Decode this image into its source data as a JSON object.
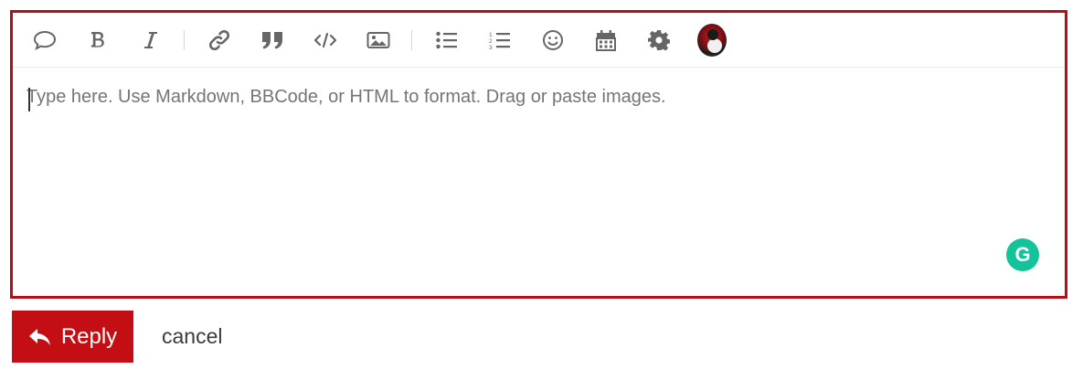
{
  "toolbar": {
    "buttons": [
      {
        "name": "blockquote",
        "icon": "speech-bubble-icon"
      },
      {
        "name": "bold",
        "icon": "bold-icon"
      },
      {
        "name": "italic",
        "icon": "italic-icon"
      },
      {
        "name": "link",
        "icon": "link-icon"
      },
      {
        "name": "quote",
        "icon": "quote-icon"
      },
      {
        "name": "code",
        "icon": "code-icon"
      },
      {
        "name": "image",
        "icon": "image-icon"
      },
      {
        "name": "bullet-list",
        "icon": "bullet-list-icon"
      },
      {
        "name": "numbered-list",
        "icon": "numbered-list-icon"
      },
      {
        "name": "emoji",
        "icon": "smiley-icon"
      },
      {
        "name": "date",
        "icon": "calendar-icon"
      },
      {
        "name": "options",
        "icon": "gear-icon"
      }
    ]
  },
  "editor": {
    "placeholder": "Type here. Use Markdown, BBCode, or HTML to format. Drag or paste images.",
    "value": ""
  },
  "grammarly": {
    "icon": "grammarly-icon",
    "label": "G"
  },
  "actions": {
    "reply_label": "Reply",
    "reply_icon": "reply-arrow-icon",
    "cancel_label": "cancel"
  },
  "colors": {
    "accent": "#c30f14",
    "editor_border": "#b40f17",
    "grammarly": "#15c39a",
    "icon": "#666666"
  }
}
